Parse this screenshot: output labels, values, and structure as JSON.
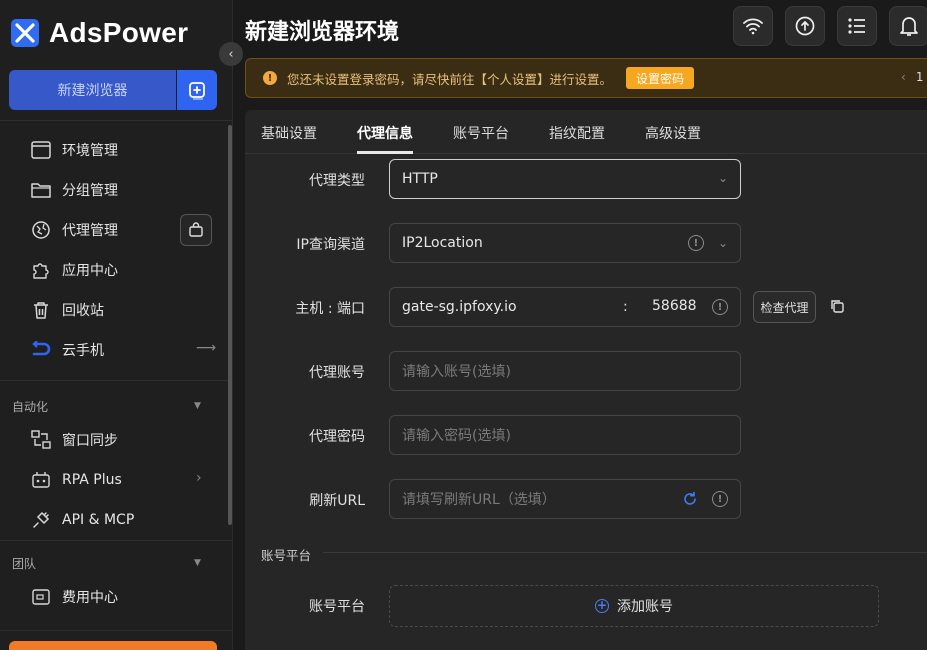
{
  "app": {
    "brand": "AdsPower",
    "page_title": "新建浏览器环境",
    "accent": "#2e64f0"
  },
  "sidebar": {
    "new_browser_label": "新建浏览器",
    "items": [
      {
        "label": "环境管理",
        "icon": "window-icon"
      },
      {
        "label": "分组管理",
        "icon": "folder-icon"
      },
      {
        "label": "代理管理",
        "icon": "proxy-globe-icon"
      },
      {
        "label": "应用中心",
        "icon": "puzzle-icon"
      },
      {
        "label": "回收站",
        "icon": "trash-icon"
      },
      {
        "label": "云手机",
        "icon": "cloud-phone-icon"
      }
    ],
    "section_automation": "自动化",
    "automation_items": [
      {
        "label": "窗口同步",
        "icon": "window-sync-icon"
      },
      {
        "label": "RPA Plus",
        "icon": "rpa-icon"
      },
      {
        "label": "API & MCP",
        "icon": "api-plug-icon"
      }
    ],
    "section_team": "团队",
    "team_items": [
      {
        "label": "费用中心",
        "icon": "billing-icon"
      }
    ]
  },
  "header": {
    "icons": [
      "wifi-icon",
      "upload-sync-icon",
      "list-icon",
      "bell-icon"
    ]
  },
  "banner": {
    "text": "您还未设置登录密码，请尽快前往【个人设置】进行设置。",
    "button": "设置密码",
    "page_num": "1",
    "warning_color": "#f5a81f"
  },
  "tabs": [
    {
      "label": "基础设置"
    },
    {
      "label": "代理信息"
    },
    {
      "label": "账号平台"
    },
    {
      "label": "指纹配置"
    },
    {
      "label": "高级设置"
    }
  ],
  "form": {
    "proxy_type_label": "代理类型",
    "proxy_type_value": "HTTP",
    "ip_channel_label": "IP查询渠道",
    "ip_channel_value": "IP2Location",
    "host_port_label": "主机 : 端口",
    "host_value": "gate-sg.ipfoxy.io",
    "colon": ":",
    "port_value": "58688",
    "check_proxy_button": "检查代理",
    "account_label": "代理账号",
    "account_placeholder": "请输入账号(选填)",
    "password_label": "代理密码",
    "password_placeholder": "请输入密码(选填)",
    "refresh_url_label": "刷新URL",
    "refresh_url_placeholder": "请填写刷新URL（选填）"
  },
  "account_platform": {
    "section_title": "账号平台",
    "label": "账号平台",
    "add_button": "添加账号"
  }
}
